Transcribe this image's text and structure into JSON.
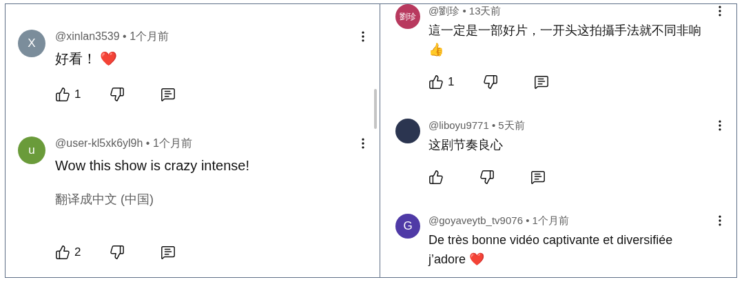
{
  "panels": [
    {
      "comments": [
        {
          "avatar": {
            "kind": "letter",
            "text": "X",
            "color": "#7b8d9b"
          },
          "byline": "@xinlan3539 • 1个月前",
          "body": "好看！ ❤️",
          "actions": true,
          "likes": "1"
        },
        {
          "avatar": {
            "kind": "letter",
            "text": "u",
            "color": "#6a9b3a"
          },
          "byline": "@user-kl5xk6yl9h • 1个月前",
          "body": "Wow this show is crazy intense!",
          "translate": "翻译成中文 (中国)",
          "actions": true,
          "likes": "2"
        }
      ]
    },
    {
      "comments": [
        {
          "avatar": {
            "kind": "letter",
            "text": "劉珍",
            "color": "#b8395e"
          },
          "byline": "@劉珍 • 13天前",
          "body": "這一定是一部好片，一开头这拍攝手法就不同非响👍",
          "actions": true,
          "likes": "1"
        },
        {
          "avatar": {
            "kind": "image",
            "color": "#2b3550"
          },
          "byline": "@liboyu9771 • 5天前",
          "body": "这剧节奏良心",
          "actions": true
        },
        {
          "avatar": {
            "kind": "letter",
            "text": "G",
            "color": "#4f3aa6"
          },
          "byline": "@goyaveytb_tv9076 • 1个月前",
          "body": "De très bonne vidéo captivante et diversifiée j’adore ❤️",
          "actions": false
        }
      ]
    }
  ]
}
